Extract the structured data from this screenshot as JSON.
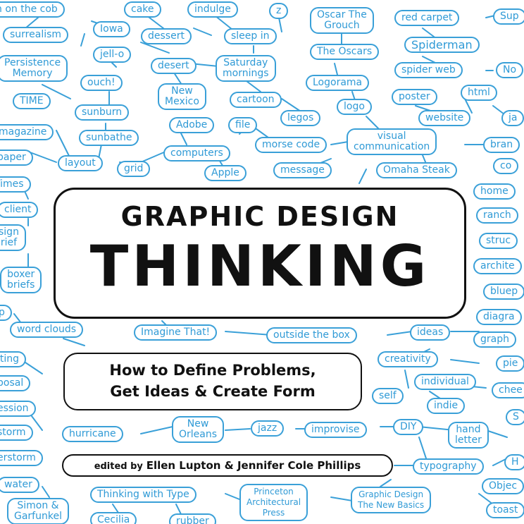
{
  "title": {
    "line1": "GRAPHIC DESIGN",
    "line2": "THINKING"
  },
  "subtitle": {
    "line1": "How to Define Problems,",
    "line2": "Get Ideas & Create Form"
  },
  "credits": {
    "prefix": "edited by",
    "names": "Ellen Lupton & Jennifer Cole Phillips"
  },
  "colors": {
    "bubble_ink": "#3aa0d8",
    "title_ink": "#111111",
    "background": "#ffffff"
  },
  "bubbles": {
    "corn": "n on the cob",
    "cake": "cake",
    "indulge": "indulge",
    "z": "z",
    "oscar": "Oscar The\nGrouch",
    "red_carpet": "red carpet",
    "sup": "Sup",
    "surrealism": "surrealism",
    "iowa": "Iowa",
    "dessert": "dessert",
    "sleep_in": "sleep in",
    "the_oscars": "The Oscars",
    "spiderman": "Spiderman",
    "jello": "jell-o",
    "persistence": "Persistence\nMemory",
    "desert": "desert",
    "saturday": "Saturday\nmornings",
    "spider_web": "spider web",
    "no": "No",
    "ouch": "ouch!",
    "logorama": "Logorama",
    "time": "TIME",
    "new_mexico": "New\nMexico",
    "cartoon": "cartoon",
    "poster": "poster",
    "html": "html",
    "sunburn": "sunburn",
    "logo": "logo",
    "legos": "legos",
    "website": "website",
    "ja": "ja",
    "magazine": "magazine",
    "adobe": "Adobe",
    "file": "file",
    "sunbathe": "sunbathe",
    "visual": "visual\ncommunication",
    "morse": "morse code",
    "bran": "bran",
    "paper": "paper",
    "layout": "layout",
    "computers": "computers",
    "grid": "grid",
    "message": "message",
    "apple": "Apple",
    "omaha": "Omaha Steak",
    "co": "co",
    "times": "Times",
    "home": "home",
    "client": "client",
    "ranch": "ranch",
    "design_brief": "sign\nrief",
    "struc": "struc",
    "boxer": "boxer\nbriefs",
    "archite": "archite",
    "bluep": "bluep",
    "p": "p",
    "diagra": "diagra",
    "word_clouds": "word clouds",
    "imagine": "Imagine That!",
    "outside": "outside the box",
    "ideas": "ideas",
    "graph": "graph",
    "writing": "iting",
    "creativity": "creativity",
    "pie": "pie",
    "proposal": "posal",
    "individual": "individual",
    "chee": "chee",
    "self": "self",
    "indie": "indie",
    "session": "ession",
    "s": "S",
    "storm": "storm",
    "new_orleans": "New\nOrleans",
    "jazz": "jazz",
    "hurricane": "hurricane",
    "improvise": "improvise",
    "diy": "DIY",
    "hand_letter": "hand\nletter",
    "thunderstorm": "erstorm",
    "h": "H",
    "typography": "typography",
    "water": "water",
    "objec": "Objec",
    "thinking_type": "Thinking with Type",
    "princeton": "Princeton\nArchitectural\nPress",
    "gd_basics": "Graphic Design\nThe New Basics",
    "simon": "Simon &\nGarfunkel",
    "cecilia": "Cecilia",
    "rubber": "rubber",
    "toast": "toast"
  }
}
